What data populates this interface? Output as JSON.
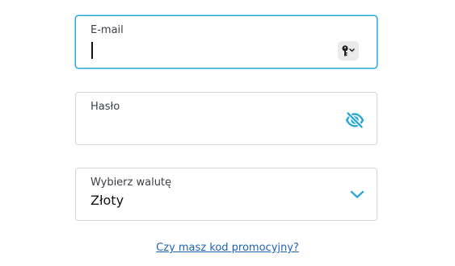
{
  "email": {
    "label": "E-mail",
    "value": "",
    "icon": "key-icon"
  },
  "password": {
    "label": "Hasło",
    "value": "",
    "icon": "eye-slash-icon"
  },
  "currency": {
    "label": "Wybierz walutę",
    "selected": "Złoty",
    "icon": "chevron-down-icon"
  },
  "promo": {
    "link_text": "Czy masz kod promocyjny?"
  },
  "colors": {
    "accent": "#2aa9d6",
    "link": "#1f63b4",
    "border": "#d4d6d9"
  }
}
